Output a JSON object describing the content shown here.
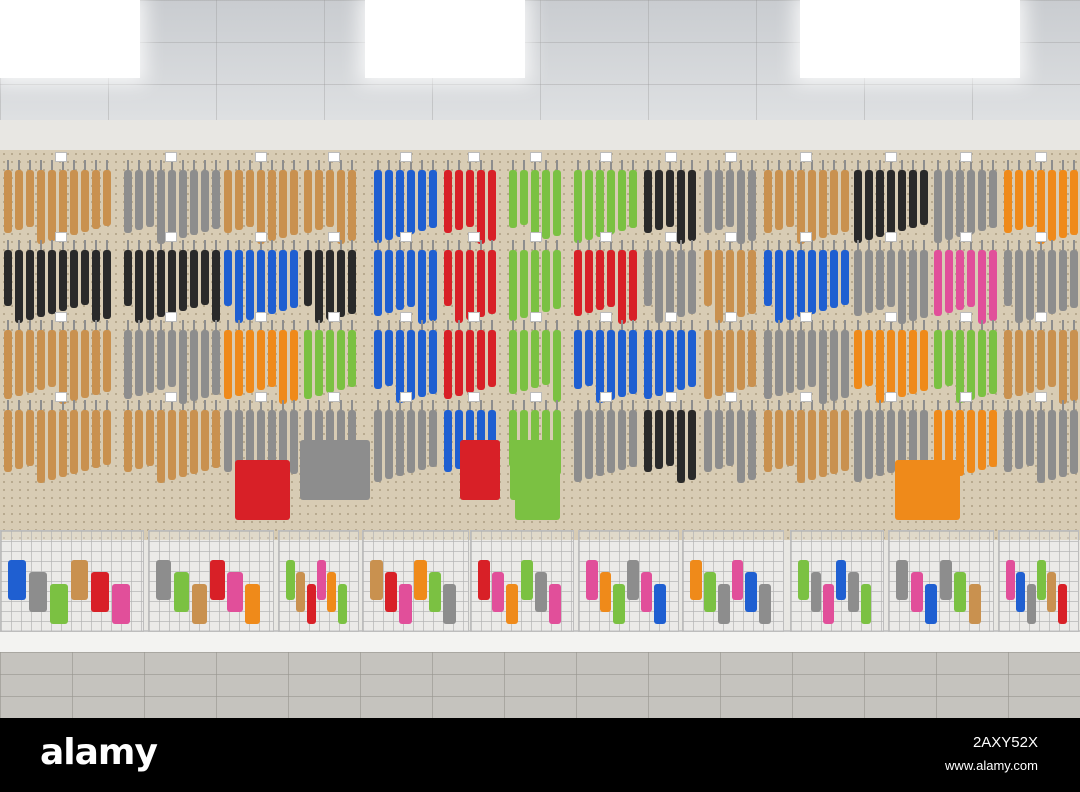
{
  "scene": {
    "subject": "store-shelf-cleaning-tools",
    "palette": {
      "wood": "#c9914f",
      "blue": "#1f5fd1",
      "red": "#d82027",
      "green": "#7bc142",
      "pink": "#e14f9a",
      "orange": "#ef8a1a",
      "black": "#2a2a2a",
      "grey": "#8d8d8d"
    }
  },
  "watermark": {
    "logo": "alamy",
    "image_id": "2AXY52X",
    "url": "www.alamy.com"
  }
}
